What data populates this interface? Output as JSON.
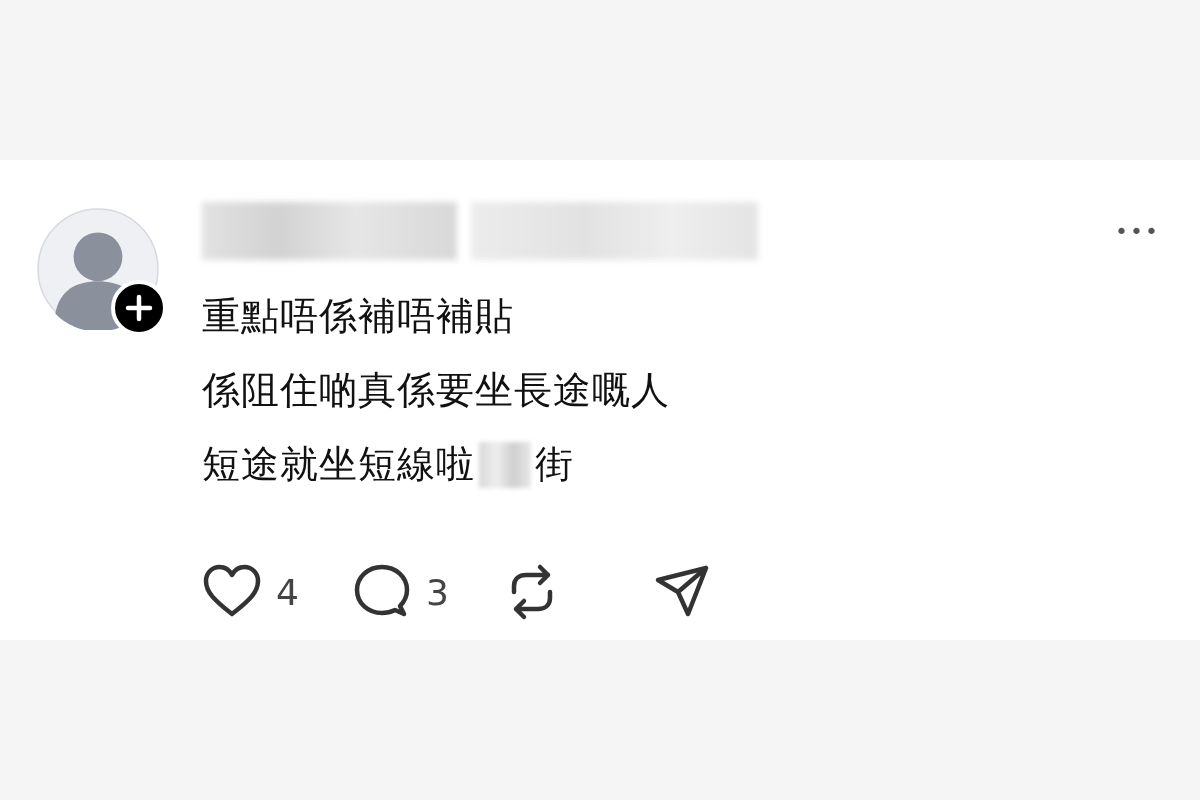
{
  "post": {
    "more_menu": "•••",
    "lines": [
      {
        "segments": [
          {
            "kind": "text",
            "text": "重點唔係補唔補貼"
          }
        ]
      },
      {
        "segments": [
          {
            "kind": "text",
            "text": "係阻住啲真係要坐長途嘅人"
          }
        ]
      },
      {
        "segments": [
          {
            "kind": "text",
            "text": "短途就坐短線啦"
          },
          {
            "kind": "redacted"
          },
          {
            "kind": "text",
            "text": "街"
          }
        ]
      }
    ],
    "actions": [
      {
        "kind": "like",
        "count": "4"
      },
      {
        "kind": "reply",
        "count": "3"
      },
      {
        "kind": "repost"
      },
      {
        "kind": "share"
      }
    ]
  }
}
